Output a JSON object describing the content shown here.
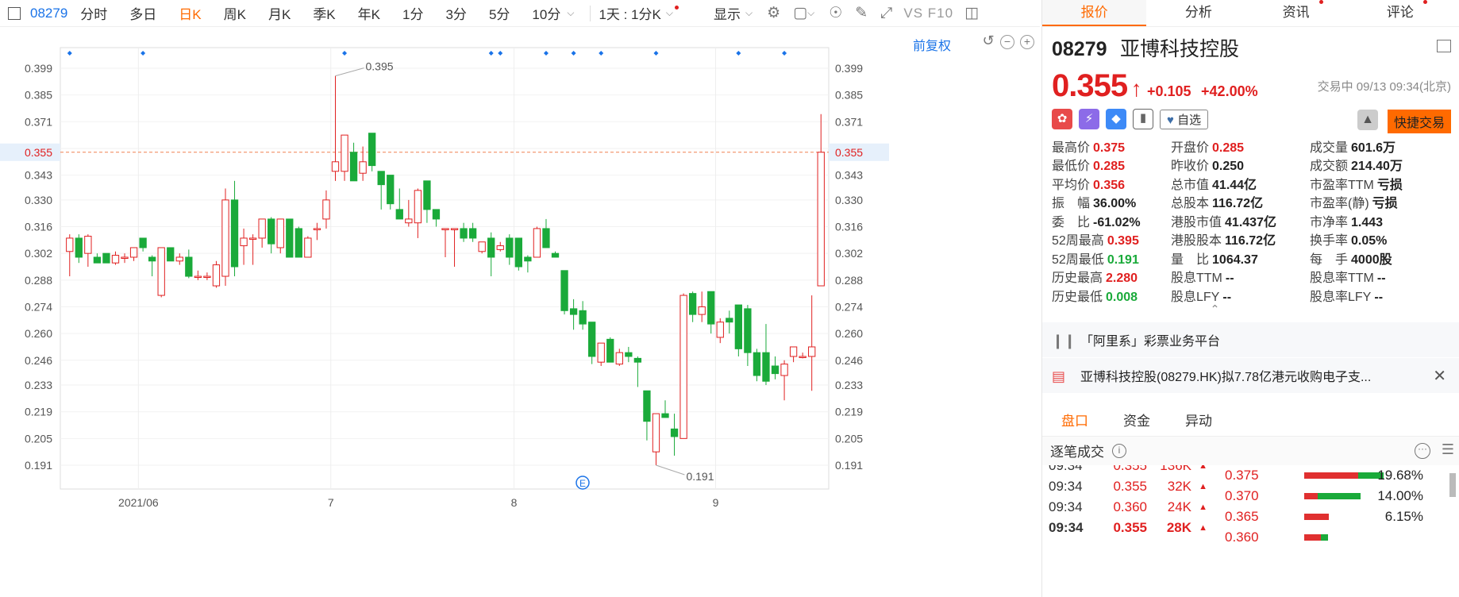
{
  "toolbar": {
    "code": "08279",
    "periods": [
      "分时",
      "多日",
      "日K",
      "周K",
      "月K",
      "季K",
      "年K",
      "1分",
      "3分",
      "5分",
      "10分"
    ],
    "active_period": "日K",
    "interval_label": "1天 : 1分K",
    "display_label": "显示",
    "vsf_label": "VS F10"
  },
  "chart": {
    "adjust_label": "前复权",
    "current_price_label": "0.355",
    "high_label": "0.395",
    "low_label": "0.191"
  },
  "chart_data": {
    "type": "candlestick",
    "y_ticks": [
      "0.399",
      "0.385",
      "0.371",
      "0.355",
      "0.343",
      "0.330",
      "0.316",
      "0.302",
      "0.288",
      "0.274",
      "0.260",
      "0.246",
      "0.233",
      "0.219",
      "0.205",
      "0.191"
    ],
    "y_tick_values": [
      0.399,
      0.385,
      0.371,
      0.357,
      0.343,
      0.33,
      0.316,
      0.302,
      0.288,
      0.274,
      0.26,
      0.246,
      0.233,
      0.219,
      0.205,
      0.191
    ],
    "x_labels": [
      "2021/06",
      "7",
      "8",
      "9"
    ],
    "x_label_index": [
      8,
      29,
      49,
      71
    ],
    "ylim": [
      0.183,
      0.405
    ],
    "current_price": 0.355,
    "event_marker_index": [
      0,
      8,
      30,
      46,
      47,
      52,
      55,
      58,
      64,
      73,
      78
    ],
    "candles": [
      {
        "o": 0.303,
        "h": 0.312,
        "l": 0.29,
        "c": 0.31
      },
      {
        "o": 0.31,
        "h": 0.312,
        "l": 0.297,
        "c": 0.3
      },
      {
        "o": 0.302,
        "h": 0.312,
        "l": 0.295,
        "c": 0.311
      },
      {
        "o": 0.3,
        "h": 0.302,
        "l": 0.297,
        "c": 0.297
      },
      {
        "o": 0.302,
        "h": 0.302,
        "l": 0.297,
        "c": 0.297
      },
      {
        "o": 0.297,
        "h": 0.303,
        "l": 0.296,
        "c": 0.301
      },
      {
        "o": 0.3,
        "h": 0.302,
        "l": 0.297,
        "c": 0.3
      },
      {
        "o": 0.3,
        "h": 0.305,
        "l": 0.298,
        "c": 0.305
      },
      {
        "o": 0.31,
        "h": 0.31,
        "l": 0.303,
        "c": 0.305
      },
      {
        "o": 0.3,
        "h": 0.301,
        "l": 0.29,
        "c": 0.298
      },
      {
        "o": 0.28,
        "h": 0.305,
        "l": 0.279,
        "c": 0.305
      },
      {
        "o": 0.305,
        "h": 0.305,
        "l": 0.298,
        "c": 0.298
      },
      {
        "o": 0.298,
        "h": 0.302,
        "l": 0.296,
        "c": 0.3
      },
      {
        "o": 0.3,
        "h": 0.304,
        "l": 0.289,
        "c": 0.29
      },
      {
        "o": 0.29,
        "h": 0.293,
        "l": 0.288,
        "c": 0.29
      },
      {
        "o": 0.29,
        "h": 0.292,
        "l": 0.288,
        "c": 0.29
      },
      {
        "o": 0.285,
        "h": 0.298,
        "l": 0.284,
        "c": 0.296
      },
      {
        "o": 0.29,
        "h": 0.336,
        "l": 0.285,
        "c": 0.33
      },
      {
        "o": 0.33,
        "h": 0.34,
        "l": 0.29,
        "c": 0.295
      },
      {
        "o": 0.306,
        "h": 0.315,
        "l": 0.296,
        "c": 0.31
      },
      {
        "o": 0.31,
        "h": 0.312,
        "l": 0.296,
        "c": 0.31
      },
      {
        "o": 0.31,
        "h": 0.32,
        "l": 0.305,
        "c": 0.32
      },
      {
        "o": 0.32,
        "h": 0.321,
        "l": 0.302,
        "c": 0.307
      },
      {
        "o": 0.305,
        "h": 0.32,
        "l": 0.302,
        "c": 0.32
      },
      {
        "o": 0.32,
        "h": 0.32,
        "l": 0.3,
        "c": 0.3
      },
      {
        "o": 0.315,
        "h": 0.316,
        "l": 0.3,
        "c": 0.3
      },
      {
        "o": 0.3,
        "h": 0.311,
        "l": 0.3,
        "c": 0.31
      },
      {
        "o": 0.315,
        "h": 0.318,
        "l": 0.309,
        "c": 0.315
      },
      {
        "o": 0.32,
        "h": 0.335,
        "l": 0.315,
        "c": 0.33
      },
      {
        "o": 0.345,
        "h": 0.395,
        "l": 0.34,
        "c": 0.35
      },
      {
        "o": 0.345,
        "h": 0.358,
        "l": 0.34,
        "c": 0.364
      },
      {
        "o": 0.355,
        "h": 0.36,
        "l": 0.34,
        "c": 0.34
      },
      {
        "o": 0.344,
        "h": 0.358,
        "l": 0.34,
        "c": 0.35
      },
      {
        "o": 0.365,
        "h": 0.365,
        "l": 0.345,
        "c": 0.348
      },
      {
        "o": 0.345,
        "h": 0.345,
        "l": 0.325,
        "c": 0.338
      },
      {
        "o": 0.343,
        "h": 0.343,
        "l": 0.325,
        "c": 0.328
      },
      {
        "o": 0.325,
        "h": 0.336,
        "l": 0.32,
        "c": 0.32
      },
      {
        "o": 0.318,
        "h": 0.33,
        "l": 0.316,
        "c": 0.32
      },
      {
        "o": 0.318,
        "h": 0.336,
        "l": 0.31,
        "c": 0.335
      },
      {
        "o": 0.34,
        "h": 0.34,
        "l": 0.318,
        "c": 0.325
      },
      {
        "o": 0.325,
        "h": 0.325,
        "l": 0.316,
        "c": 0.32
      },
      {
        "o": 0.315,
        "h": 0.315,
        "l": 0.3,
        "c": 0.315
      },
      {
        "o": 0.315,
        "h": 0.315,
        "l": 0.295,
        "c": 0.315
      },
      {
        "o": 0.315,
        "h": 0.318,
        "l": 0.308,
        "c": 0.31
      },
      {
        "o": 0.315,
        "h": 0.318,
        "l": 0.308,
        "c": 0.31
      },
      {
        "o": 0.303,
        "h": 0.308,
        "l": 0.302,
        "c": 0.308
      },
      {
        "o": 0.31,
        "h": 0.313,
        "l": 0.29,
        "c": 0.3
      },
      {
        "o": 0.304,
        "h": 0.308,
        "l": 0.303,
        "c": 0.306
      },
      {
        "o": 0.31,
        "h": 0.312,
        "l": 0.296,
        "c": 0.3
      },
      {
        "o": 0.31,
        "h": 0.31,
        "l": 0.293,
        "c": 0.295
      },
      {
        "o": 0.3,
        "h": 0.301,
        "l": 0.292,
        "c": 0.298
      },
      {
        "o": 0.3,
        "h": 0.316,
        "l": 0.3,
        "c": 0.315
      },
      {
        "o": 0.315,
        "h": 0.32,
        "l": 0.305,
        "c": 0.305
      },
      {
        "o": 0.302,
        "h": 0.303,
        "l": 0.3,
        "c": 0.3
      },
      {
        "o": 0.293,
        "h": 0.293,
        "l": 0.27,
        "c": 0.272
      },
      {
        "o": 0.273,
        "h": 0.278,
        "l": 0.262,
        "c": 0.27
      },
      {
        "o": 0.272,
        "h": 0.277,
        "l": 0.262,
        "c": 0.265
      },
      {
        "o": 0.266,
        "h": 0.266,
        "l": 0.244,
        "c": 0.248
      },
      {
        "o": 0.245,
        "h": 0.255,
        "l": 0.243,
        "c": 0.255
      },
      {
        "o": 0.257,
        "h": 0.258,
        "l": 0.245,
        "c": 0.245
      },
      {
        "o": 0.244,
        "h": 0.252,
        "l": 0.243,
        "c": 0.25
      },
      {
        "o": 0.25,
        "h": 0.253,
        "l": 0.245,
        "c": 0.248
      },
      {
        "o": 0.247,
        "h": 0.248,
        "l": 0.232,
        "c": 0.245
      },
      {
        "o": 0.23,
        "h": 0.23,
        "l": 0.204,
        "c": 0.214
      },
      {
        "o": 0.198,
        "h": 0.218,
        "l": 0.191,
        "c": 0.218
      },
      {
        "o": 0.218,
        "h": 0.225,
        "l": 0.217,
        "c": 0.216
      },
      {
        "o": 0.21,
        "h": 0.218,
        "l": 0.196,
        "c": 0.206
      },
      {
        "o": 0.205,
        "h": 0.281,
        "l": 0.205,
        "c": 0.28
      },
      {
        "o": 0.281,
        "h": 0.282,
        "l": 0.266,
        "c": 0.27
      },
      {
        "o": 0.27,
        "h": 0.282,
        "l": 0.266,
        "c": 0.274
      },
      {
        "o": 0.282,
        "h": 0.282,
        "l": 0.26,
        "c": 0.265
      },
      {
        "o": 0.258,
        "h": 0.268,
        "l": 0.255,
        "c": 0.266
      },
      {
        "o": 0.268,
        "h": 0.272,
        "l": 0.26,
        "c": 0.266
      },
      {
        "o": 0.275,
        "h": 0.275,
        "l": 0.248,
        "c": 0.252
      },
      {
        "o": 0.273,
        "h": 0.275,
        "l": 0.243,
        "c": 0.25
      },
      {
        "o": 0.25,
        "h": 0.252,
        "l": 0.235,
        "c": 0.238
      },
      {
        "o": 0.25,
        "h": 0.265,
        "l": 0.233,
        "c": 0.235
      },
      {
        "o": 0.243,
        "h": 0.248,
        "l": 0.236,
        "c": 0.239
      },
      {
        "o": 0.238,
        "h": 0.246,
        "l": 0.225,
        "c": 0.244
      },
      {
        "o": 0.248,
        "h": 0.252,
        "l": 0.245,
        "c": 0.253
      },
      {
        "o": 0.248,
        "h": 0.25,
        "l": 0.247,
        "c": 0.248
      },
      {
        "o": 0.248,
        "h": 0.28,
        "l": 0.23,
        "c": 0.253
      },
      {
        "o": 0.285,
        "h": 0.375,
        "l": 0.285,
        "c": 0.355
      }
    ]
  },
  "panel": {
    "tabs": [
      "报价",
      "分析",
      "资讯",
      "评论"
    ],
    "active_tab": "报价",
    "stock_code": "08279",
    "stock_name": "亚博科技控股",
    "price": "0.355",
    "change": "+0.105",
    "change_pct": "+42.00%",
    "status": "交易中 09/13 09:34(北京)",
    "fav_label": "自选",
    "quick_trade_label": "快捷交易",
    "stats": [
      [
        {
          "label": "最高价",
          "value": "0.375",
          "color": "red"
        },
        {
          "label": "开盘价",
          "value": "0.285",
          "color": "red"
        },
        {
          "label": "成交量",
          "value": "601.6万",
          "color": "dark"
        }
      ],
      [
        {
          "label": "最低价",
          "value": "0.285",
          "color": "red"
        },
        {
          "label": "昨收价",
          "value": "0.250",
          "color": "dark"
        },
        {
          "label": "成交额",
          "value": "214.40万",
          "color": "dark"
        }
      ],
      [
        {
          "label": "平均价",
          "value": "0.356",
          "color": "red"
        },
        {
          "label": "总市值",
          "value": "41.44亿",
          "color": "dark"
        },
        {
          "label": "市盈率TTM",
          "value": "亏损",
          "color": "dark"
        }
      ],
      [
        {
          "label": "振　幅",
          "value": "36.00%",
          "color": "dark"
        },
        {
          "label": "总股本",
          "value": "116.72亿",
          "color": "dark"
        },
        {
          "label": "市盈率(静)",
          "value": "亏损",
          "color": "dark"
        }
      ],
      [
        {
          "label": "委　比",
          "value": "-61.02%",
          "color": "dark"
        },
        {
          "label": "港股市值",
          "value": "41.437亿",
          "color": "dark"
        },
        {
          "label": "市净率",
          "value": "1.443",
          "color": "dark"
        }
      ],
      [
        {
          "label": "52周最高",
          "value": "0.395",
          "color": "red"
        },
        {
          "label": "港股股本",
          "value": "116.72亿",
          "color": "dark"
        },
        {
          "label": "换手率",
          "value": "0.05%",
          "color": "dark"
        }
      ],
      [
        {
          "label": "52周最低",
          "value": "0.191",
          "color": "green"
        },
        {
          "label": "量　比",
          "value": "1064.37",
          "color": "dark"
        },
        {
          "label": "每　手",
          "value": "4000股",
          "color": "dark"
        }
      ],
      [
        {
          "label": "历史最高",
          "value": "2.280",
          "color": "red"
        },
        {
          "label": "股息TTM",
          "value": "--",
          "color": "dark"
        },
        {
          "label": "股息率TTM",
          "value": "--",
          "color": "dark"
        }
      ],
      [
        {
          "label": "历史最低",
          "value": "0.008",
          "color": "green"
        },
        {
          "label": "股息LFY",
          "value": "--",
          "color": "dark"
        },
        {
          "label": "股息率LFY",
          "value": "--",
          "color": "dark"
        }
      ]
    ],
    "news": [
      "「阿里系」彩票业务平台",
      "亚博科技控股(08279.HK)拟7.78亿港元收购电子支..."
    ],
    "subtabs": [
      "盘口",
      "资金",
      "异动"
    ],
    "active_subtab": "盘口",
    "tick_title": "逐笔成交",
    "ticks": [
      {
        "time": "09:34",
        "price": "0.355",
        "qty": "136K"
      },
      {
        "time": "09:34",
        "price": "0.355",
        "qty": "32K"
      },
      {
        "time": "09:34",
        "price": "0.360",
        "qty": "24K"
      },
      {
        "time": "09:34",
        "price": "0.355",
        "qty": "28K"
      }
    ],
    "distribution": [
      {
        "price": "0.375",
        "pct": "19.68%",
        "red": 0.68,
        "green": 0.32
      },
      {
        "price": "0.370",
        "pct": "14.00%",
        "red": 0.24,
        "green": 0.76
      },
      {
        "price": "0.365",
        "pct": "6.15%",
        "red": 1.0,
        "green": 0.0
      },
      {
        "price": "0.360",
        "pct": "",
        "red": 0.7,
        "green": 0.3
      }
    ]
  },
  "colors": {
    "up": "#e02020",
    "down": "#1aaa3a",
    "accent": "#ff6a00",
    "link": "#1a73e8"
  }
}
